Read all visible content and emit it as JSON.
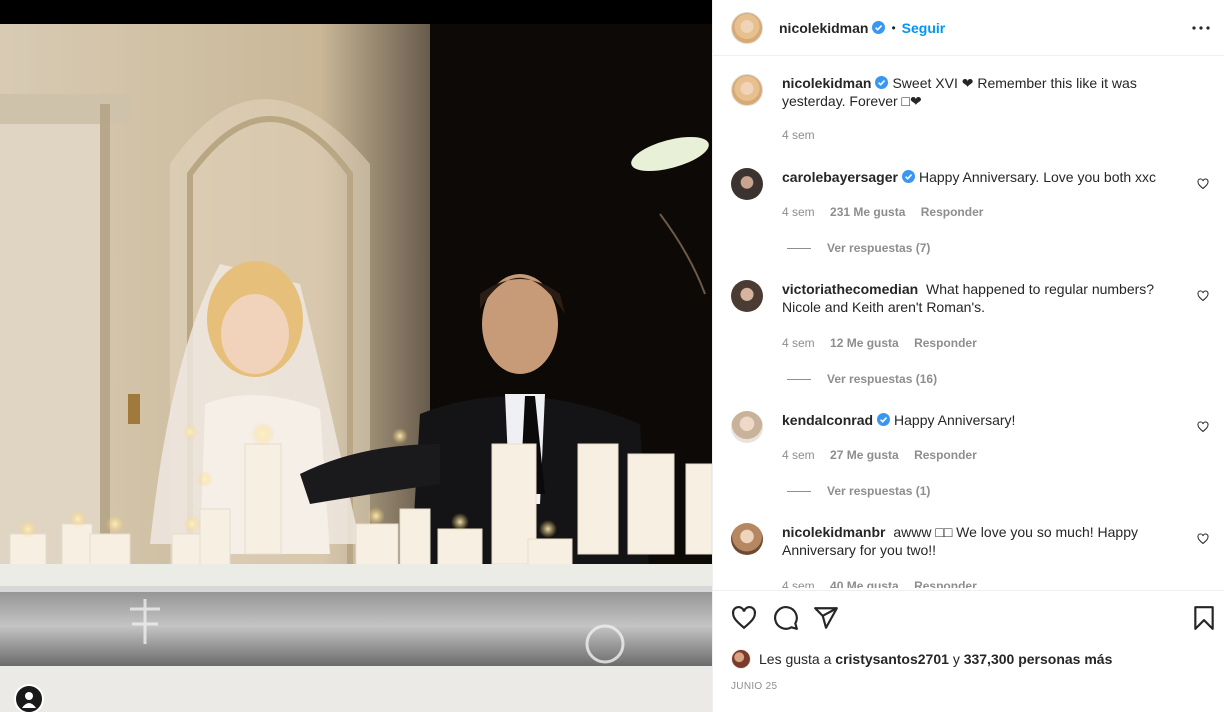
{
  "post": {
    "author": "nicolekidman",
    "follow_label": "Seguir",
    "separator": "•",
    "caption": "Sweet XVI ❤ Remember this like it was yesterday. Forever □❤",
    "caption_time": "4 sem"
  },
  "comments": [
    {
      "user": "carolebayersager",
      "verified": true,
      "text": "Happy Anniversary. Love you both xxc",
      "time": "4 sem",
      "likes": "231 Me gusta",
      "reply": "Responder",
      "replies_label": "Ver respuestas (7)"
    },
    {
      "user": "victoriathecomedian",
      "verified": false,
      "text": "What happened to regular numbers? Nicole and Keith aren't Roman's.",
      "time": "4 sem",
      "likes": "12 Me gusta",
      "reply": "Responder",
      "replies_label": "Ver respuestas (16)"
    },
    {
      "user": "kendalconrad",
      "verified": true,
      "text": "Happy Anniversary!",
      "time": "4 sem",
      "likes": "27 Me gusta",
      "reply": "Responder",
      "replies_label": "Ver respuestas (1)"
    },
    {
      "user": "nicolekidmanbr",
      "verified": false,
      "text": "awww □□ We love you so much! Happy Anniversary for you two!!",
      "time": "4 sem",
      "likes": "40 Me gusta",
      "reply": "Responder"
    }
  ],
  "footer": {
    "likes_prefix": "Les gusta a",
    "likes_user": "cristysantos2701",
    "likes_connector": "y",
    "likes_count": "337,300 personas más",
    "date": "JUNIO 25"
  },
  "colors": {
    "accent": "#0095f6",
    "verified": "#3897f0",
    "secondary_text": "#8e8e8e"
  },
  "icons": [
    "verified-icon",
    "more-icon",
    "heart-icon",
    "comment-icon",
    "share-icon",
    "bookmark-icon",
    "person-tag-icon"
  ]
}
